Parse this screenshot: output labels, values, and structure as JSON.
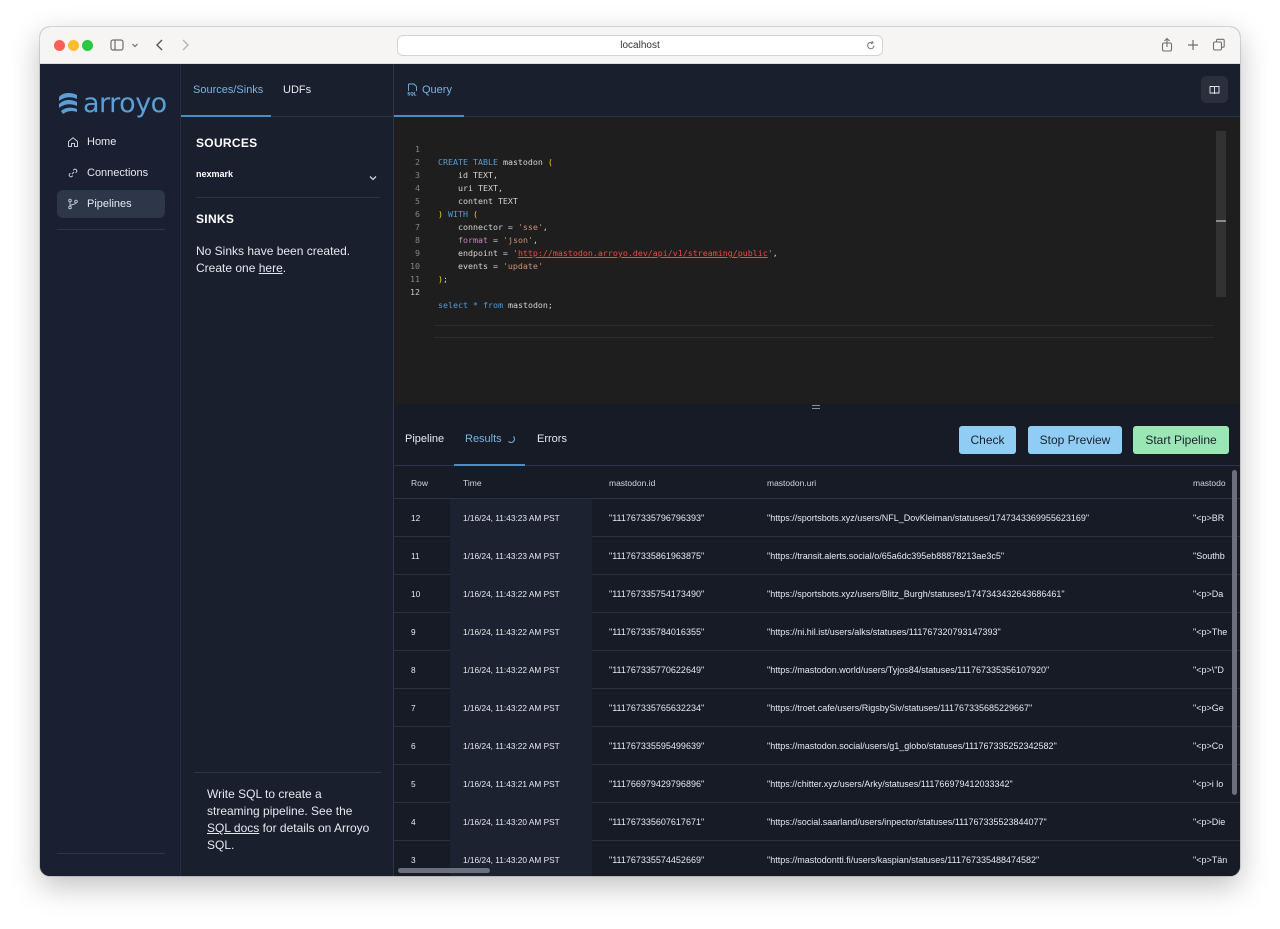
{
  "browser": {
    "address": "localhost"
  },
  "nav": {
    "logo": "arroyo",
    "items": [
      {
        "label": "Home",
        "icon": "home-icon"
      },
      {
        "label": "Connections",
        "icon": "link-icon"
      },
      {
        "label": "Pipelines",
        "icon": "branch-icon",
        "active": true
      }
    ]
  },
  "side": {
    "tabs": [
      "Sources/Sinks",
      "UDFs"
    ],
    "sources_heading": "SOURCES",
    "source_item": "nexmark",
    "sinks_heading": "SINKS",
    "sinks_text": "No Sinks have been created. Create one",
    "sinks_link": "here",
    "sinks_period": ".",
    "help_before": "Write SQL to create a streaming pipeline. See the",
    "help_link": "SQL docs",
    "help_after": "for details on Arroyo SQL."
  },
  "editor": {
    "tab": "Query",
    "line_numbers": [
      "1",
      "2",
      "3",
      "4",
      "5",
      "6",
      "7",
      "8",
      "9",
      "10",
      "11",
      "12"
    ],
    "lines": [
      "CREATE TABLE mastodon (",
      "    id TEXT,",
      "    uri TEXT,",
      "    content TEXT",
      ") WITH (",
      "    connector = 'sse',",
      "    format = 'json',",
      "    endpoint = 'http://mastodon.arroyo.dev/api/v1/streaming/public',",
      "    events = 'update'",
      ");",
      "",
      "select * from mastodon;"
    ]
  },
  "results": {
    "tabs": [
      "Pipeline",
      "Results",
      "Errors"
    ],
    "buttons": {
      "check": "Check",
      "stop": "Stop Preview",
      "start": "Start Pipeline"
    },
    "columns": [
      "Row",
      "Time",
      "mastodon.id",
      "mastodon.uri",
      "mastodo"
    ],
    "rows": [
      {
        "row": "12",
        "time": "1/16/24, 11:43:23 AM PST",
        "id": "\"111767335796796393\"",
        "uri": "\"https://sportsbots.xyz/users/NFL_DovKleiman/statuses/1747343369955623169\"",
        "content": "\"<p>BR"
      },
      {
        "row": "11",
        "time": "1/16/24, 11:43:23 AM PST",
        "id": "\"111767335861963875\"",
        "uri": "\"https://transit.alerts.social/o/65a6dc395eb88878213ae3c5\"",
        "content": "\"Southb"
      },
      {
        "row": "10",
        "time": "1/16/24, 11:43:22 AM PST",
        "id": "\"111767335754173490\"",
        "uri": "\"https://sportsbots.xyz/users/Blitz_Burgh/statuses/1747343432643686461\"",
        "content": "\"<p>Da"
      },
      {
        "row": "9",
        "time": "1/16/24, 11:43:22 AM PST",
        "id": "\"111767335784016355\"",
        "uri": "\"https://ni.hil.ist/users/alks/statuses/111767320793147393\"",
        "content": "\"<p>The"
      },
      {
        "row": "8",
        "time": "1/16/24, 11:43:22 AM PST",
        "id": "\"111767335770622649\"",
        "uri": "\"https://mastodon.world/users/Tyjos84/statuses/111767335356107920\"",
        "content": "\"<p>\\\"D"
      },
      {
        "row": "7",
        "time": "1/16/24, 11:43:22 AM PST",
        "id": "\"111767335765632234\"",
        "uri": "\"https://troet.cafe/users/RigsbySiv/statuses/111767335685229667\"",
        "content": "\"<p>Ge"
      },
      {
        "row": "6",
        "time": "1/16/24, 11:43:22 AM PST",
        "id": "\"111767335595499639\"",
        "uri": "\"https://mastodon.social/users/g1_globo/statuses/111767335252342582\"",
        "content": "\"<p>Co"
      },
      {
        "row": "5",
        "time": "1/16/24, 11:43:21 AM PST",
        "id": "\"111766979429796896\"",
        "uri": "\"https://chitter.xyz/users/Arky/statuses/111766979412033342\"",
        "content": "\"<p>i lo"
      },
      {
        "row": "4",
        "time": "1/16/24, 11:43:20 AM PST",
        "id": "\"111767335607617671\"",
        "uri": "\"https://social.saarland/users/inpector/statuses/111767335523844077\"",
        "content": "\"<p>Die"
      },
      {
        "row": "3",
        "time": "1/16/24, 11:43:20 AM PST",
        "id": "\"111767335574452669\"",
        "uri": "\"https://mastodontti.fi/users/kaspian/statuses/111767335488474582\"",
        "content": "\"<p>Tän"
      }
    ]
  },
  "colors": {
    "accent": "#78b4e4",
    "button_blue": "#90cdf4",
    "button_green": "#9ae6b4",
    "nav_bg": "#1a2031",
    "editor_bg": "#1e1e1e"
  }
}
